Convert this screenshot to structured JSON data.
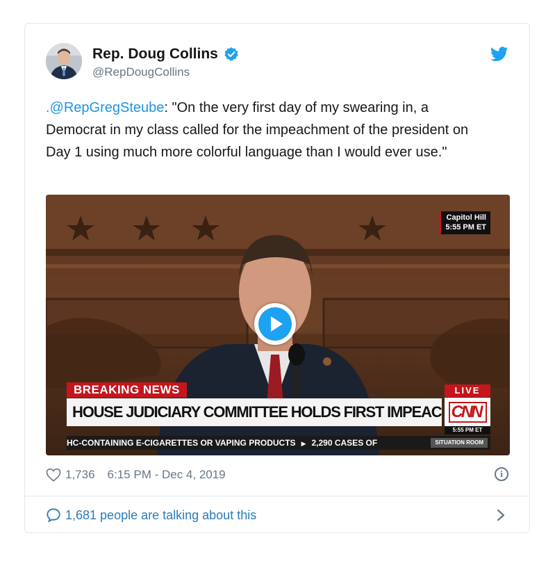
{
  "tweet": {
    "author": {
      "name": "Rep. Doug Collins",
      "handle": "@RepDougCollins",
      "verified": true,
      "verified_icon": "verified-badge-icon"
    },
    "brand_icon": "twitter-bird-icon",
    "text": {
      "mention": ".@RepGregSteube",
      "body": ": \"On the very first day of my swearing in, a Democrat in my class called for the impeachment of the president on Day 1 using much more colorful language than I would ever use.\""
    },
    "media": {
      "play_icon": "play-icon",
      "location": "Capitol Hill",
      "location_time": "5:55 PM ET",
      "breaking_label": "BREAKING NEWS",
      "headline": "HOUSE JUDICIARY COMMITTEE HOLDS FIRST IMPEACHMENT HEARING",
      "live_label": "LIVE",
      "network": "CNN",
      "network_time": "5:55 PM ET",
      "ticker_left": "HC-CONTAINING E-CIGARETTES OR VAPING PRODUCTS",
      "ticker_right": "2,290 CASES OF",
      "show_name": "SITUATION ROOM"
    },
    "likes": "1,736",
    "timestamp": "6:15 PM - Dec 4, 2019",
    "talking": "1,681 people are talking about this"
  },
  "colors": {
    "link_blue": "#1b95e0",
    "talk_blue": "#2b7bb9",
    "secondary_gray": "#657786",
    "cnn_red": "#c4161c",
    "border": "#e1e8ed"
  }
}
